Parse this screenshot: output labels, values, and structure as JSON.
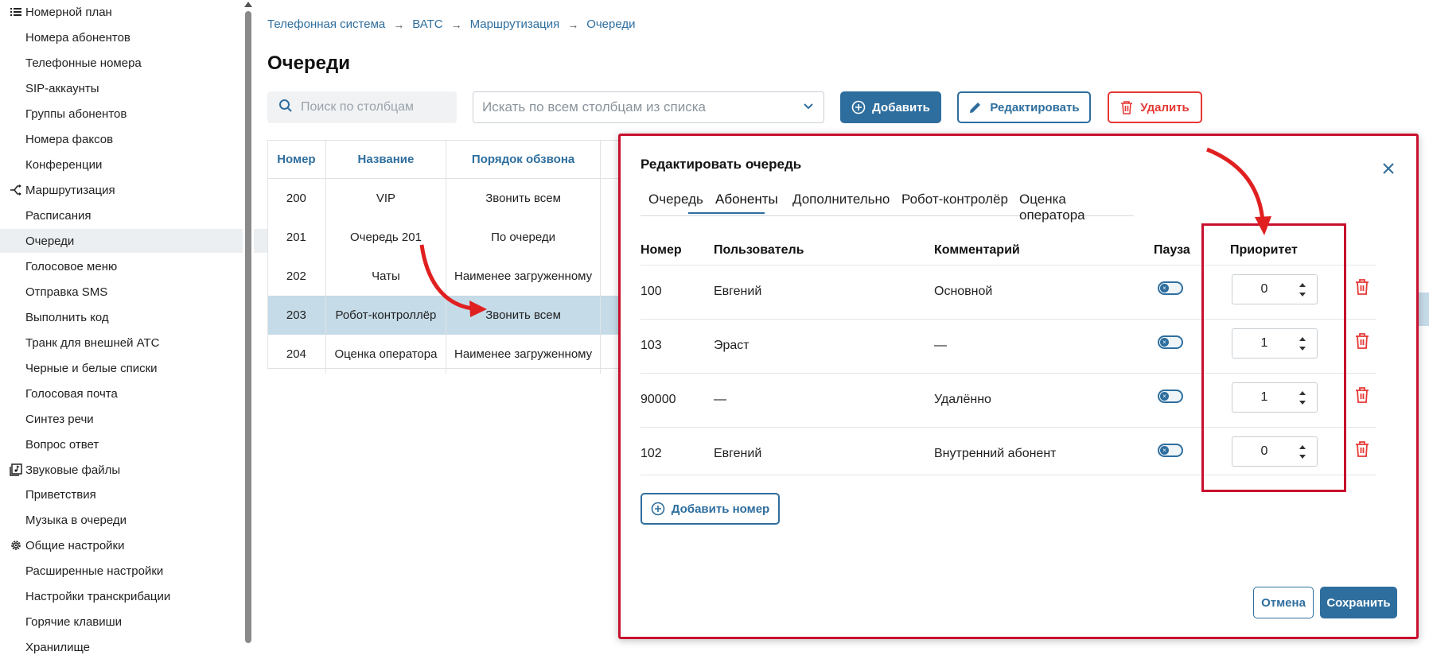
{
  "sidebar": {
    "groups": [
      {
        "label": "Номерной план",
        "icon": "list-icon"
      },
      {
        "label": "Маршрутизация",
        "icon": "routing-icon"
      },
      {
        "label": "Звуковые файлы",
        "icon": "audio-files-icon"
      },
      {
        "label": "Общие настройки",
        "icon": "gear-icon"
      }
    ],
    "items": [
      "Номера абонентов",
      "Телефонные номера",
      "SIP-аккаунты",
      "Группы абонентов",
      "Номера факсов",
      "Конференции",
      "Расписания",
      "Очереди",
      "Голосовое меню",
      "Отправка SMS",
      "Выполнить код",
      "Транк для внешней АТС",
      "Черные и белые списки",
      "Голосовая почта",
      "Синтез речи",
      "Вопрос ответ",
      "Приветствия",
      "Музыка в очереди",
      "Расширенные настройки",
      "Настройки транскрибации",
      "Горячие клавиши",
      "Хранилище"
    ],
    "selected": "Очереди"
  },
  "breadcrumb": [
    "Телефонная система",
    "ВАТС",
    "Маршрутизация",
    "Очереди"
  ],
  "page": {
    "title": "Очереди"
  },
  "toolbar": {
    "search_placeholder": "Поиск по столбцам",
    "filter_placeholder": "Искать по всем столбцам из списка",
    "add_label": "Добавить",
    "edit_label": "Редактировать",
    "delete_label": "Удалить"
  },
  "queue_table": {
    "headers": [
      "Номер",
      "Название",
      "Порядок обзвона"
    ],
    "rows": [
      [
        "200",
        "VIP",
        "Звонить всем"
      ],
      [
        "201",
        "Очередь 201",
        "По очереди"
      ],
      [
        "202",
        "Чаты",
        "Наименее загруженному"
      ],
      [
        "203",
        "Робот-контроллёр",
        "Звонить всем"
      ],
      [
        "204",
        "Оценка оператора",
        "Наименее загруженному"
      ]
    ],
    "selected_row": "203"
  },
  "modal": {
    "title": "Редактировать очередь",
    "tabs": [
      "Очередь",
      "Абоненты",
      "Дополнительно",
      "Робот-контролёр",
      "Оценка оператора"
    ],
    "active_tab": "Абоненты",
    "headers": {
      "number": "Номер",
      "user": "Пользователь",
      "comment": "Комментарий",
      "pause": "Пауза",
      "priority": "Приоритет"
    },
    "rows": [
      {
        "number": "100",
        "user": "Евгений",
        "comment": "Основной",
        "priority": "0"
      },
      {
        "number": "103",
        "user": "Эраст",
        "comment": "—",
        "priority": "1"
      },
      {
        "number": "90000",
        "user": "—",
        "comment": "Удалённо",
        "priority": "1"
      },
      {
        "number": "102",
        "user": "Евгений",
        "comment": "Внутренний абонент",
        "priority": "0"
      }
    ],
    "add_number_label": "Добавить номер",
    "cancel_label": "Отмена",
    "save_label": "Сохранить"
  },
  "colors": {
    "accent": "#2e6e9e",
    "danger": "#e53935",
    "annotation": "#c8102e",
    "selection": "#c5dbe8"
  }
}
